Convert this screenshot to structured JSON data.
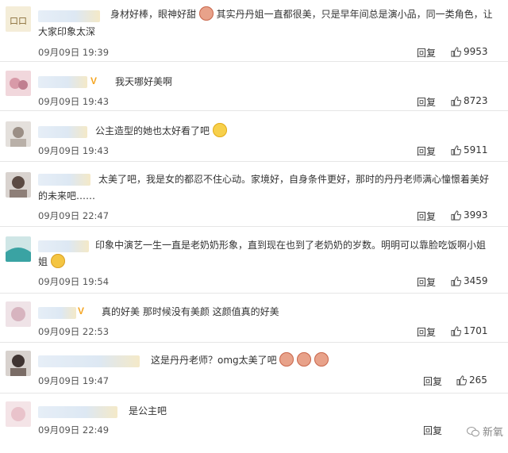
{
  "comments": [
    {
      "text": "身材好棒，眼神好甜",
      "emoji_after_line1": "其实丹丹姐一直都很美，只是早年间总是演小品，同一类角色，让",
      "text_line2": "大家印象太深",
      "datetime": "09月09日 19:39",
      "reply_label": "回复",
      "likes": "9953"
    },
    {
      "text": "我天哪好美啊",
      "verified": "V",
      "datetime": "09月09日 19:43",
      "reply_label": "回复",
      "likes": "8723"
    },
    {
      "text": "公主造型的她也太好看了吧",
      "datetime": "09月09日 19:43",
      "reply_label": "回复",
      "likes": "5911"
    },
    {
      "text": "太美了吧，我是女的都忍不住心动。家境好，自身条件更好，那时的丹丹老师满心憧憬着美好",
      "text_line2": "的未来吧……",
      "datetime": "09月09日 22:47",
      "reply_label": "回复",
      "likes": "3993"
    },
    {
      "text": "印象中演艺一生一直是老奶奶形象，直到现在也到了老奶奶的岁数。明明可以靠脸吃饭啊小姐",
      "text_line2": "姐",
      "datetime": "09月09日 19:54",
      "reply_label": "回复",
      "likes": "3459"
    },
    {
      "text": "真的好美 那时候没有美颜 这颜值真的好美",
      "verified": "V",
      "datetime": "09月09日 22:53",
      "reply_label": "回复",
      "likes": "1701"
    },
    {
      "text": "这是丹丹老师？omg太美了吧",
      "datetime": "09月09日 19:47",
      "reply_label": "回复",
      "likes": "265"
    },
    {
      "text": "是公主吧",
      "datetime": "09月09日 22:49",
      "reply_label": "回复"
    }
  ],
  "watermark": "新氧",
  "icons": {
    "like": "thumbs-up-icon"
  },
  "colors": {
    "verified": "#f5a623",
    "divider": "#e6e6e6"
  }
}
